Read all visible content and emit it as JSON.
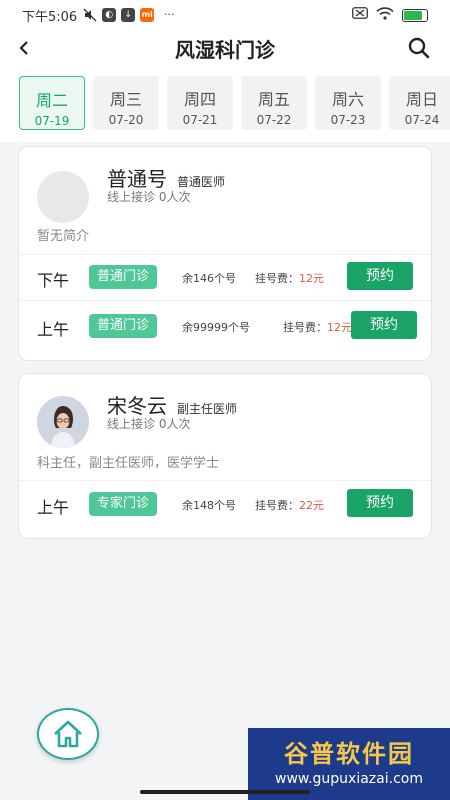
{
  "status_bar": {
    "time": "下午5:06",
    "icons": [
      "mute-icon",
      "app-icon",
      "download-icon",
      "mi-icon",
      "more-dots-icon",
      "sim-icon",
      "wifi-icon",
      "battery-icon"
    ],
    "more": "···",
    "mi_label": "mi",
    "battery_level": 0.85
  },
  "nav": {
    "title": "风湿科门诊",
    "back_icon": "chevron-left-icon",
    "search_icon": "search-icon"
  },
  "dates": [
    {
      "weekday": "周二",
      "date": "07-19",
      "active": true
    },
    {
      "weekday": "周三",
      "date": "07-20",
      "active": false
    },
    {
      "weekday": "周四",
      "date": "07-21",
      "active": false
    },
    {
      "weekday": "周五",
      "date": "07-22",
      "active": false
    },
    {
      "weekday": "周六",
      "date": "07-23",
      "active": false
    },
    {
      "weekday": "周日",
      "date": "07-24",
      "active": false
    }
  ],
  "doctors": [
    {
      "name": "普通号",
      "title": "普通医师",
      "online": "线上接诊 0人次",
      "intro": "暂无简介",
      "schedules": [
        {
          "period": "下午",
          "type": "普通门诊",
          "remain": "余146个号",
          "fee_label": "挂号费：",
          "fee": "12元",
          "book": "预约"
        },
        {
          "period": "上午",
          "type": "普通门诊",
          "remain": "余99999个号",
          "fee_label": "挂号费：",
          "fee": "12元",
          "book": "预约"
        }
      ]
    },
    {
      "name": "宋冬云",
      "title": "副主任医师",
      "online": "线上接诊 0人次",
      "intro": "科主任，副主任医师，医学学士",
      "schedules": [
        {
          "period": "上午",
          "type": "专家门诊",
          "remain": "余148个号",
          "fee_label": "挂号费：",
          "fee": "22元",
          "book": "预约"
        }
      ]
    }
  ],
  "home_icon": "home-icon",
  "watermark": {
    "main": "谷普软件园",
    "url": "www.gupuxiazai.com"
  },
  "colors": {
    "accent": "#1aa467",
    "tag": "#4fc796",
    "price": "#e0584a"
  }
}
